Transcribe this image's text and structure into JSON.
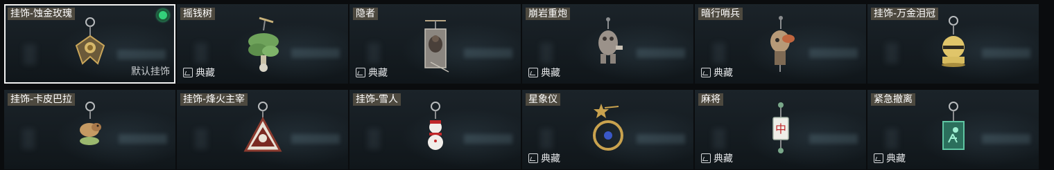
{
  "items": [
    {
      "name": "挂饰-蚀金玫瑰",
      "selected": true,
      "default_label": "默认挂饰",
      "charm_icon": "golden-rose-charm-icon"
    },
    {
      "name": "摇钱树",
      "collect_label": "典藏",
      "charm_icon": "money-tree-charm-icon"
    },
    {
      "name": "隐者",
      "collect_label": "典藏",
      "charm_icon": "hermit-charm-icon"
    },
    {
      "name": "崩岩重炮",
      "collect_label": "典藏",
      "charm_icon": "rock-cannon-charm-icon"
    },
    {
      "name": "暗行哨兵",
      "collect_label": "典藏",
      "charm_icon": "shadow-sentinel-charm-icon"
    },
    {
      "name": "挂饰-万金泪冠",
      "charm_icon": "golden-crown-charm-icon"
    },
    {
      "name": "挂饰-卡皮巴拉",
      "charm_icon": "capybara-charm-icon"
    },
    {
      "name": "挂饰-烽火主宰",
      "charm_icon": "triangle-emblem-charm-icon"
    },
    {
      "name": "挂饰-雪人",
      "charm_icon": "snowman-charm-icon"
    },
    {
      "name": "星象仪",
      "collect_label": "典藏",
      "charm_icon": "astrolabe-charm-icon"
    },
    {
      "name": "麻将",
      "collect_label": "典藏",
      "charm_icon": "mahjong-tile-charm-icon"
    },
    {
      "name": "紧急撤离",
      "collect_label": "典藏",
      "charm_icon": "emergency-exit-charm-icon"
    }
  ],
  "colors": {
    "selected_border": "#f2f2f2",
    "status_dot": "#33d07a",
    "name_tag_bg": "#5c5446"
  },
  "icons": {
    "collect": "collection-icon"
  }
}
